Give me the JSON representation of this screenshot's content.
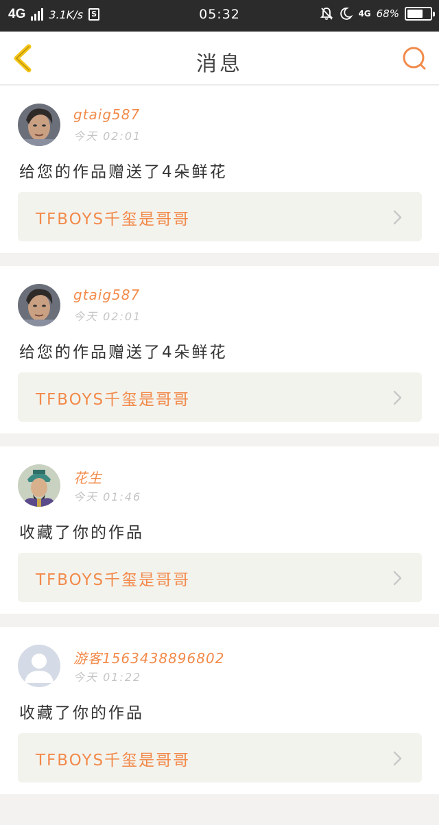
{
  "status_bar": {
    "network": "4G",
    "speed": "3.1K/s",
    "sim_icon_label": "S",
    "time": "05:32",
    "data_label": "4G",
    "battery_text": "68%",
    "battery_level": 0.68,
    "icons": [
      "signal-icon",
      "sim-icon",
      "mute-bell-icon",
      "moon-icon",
      "battery-icon"
    ]
  },
  "nav": {
    "title": "消息",
    "back_icon": "chevron-left-icon",
    "search_icon": "search-icon",
    "accent_color": "#f28a4a",
    "back_color": "#f5c518"
  },
  "messages": [
    {
      "username": "gtaig587",
      "time": "今天 02:01",
      "text": "给您的作品赠送了4朵鲜花",
      "work_title": "TFBOYS千玺是哥哥",
      "avatar": "user-photo"
    },
    {
      "username": "gtaig587",
      "time": "今天 02:01",
      "text": "给您的作品赠送了4朵鲜花",
      "work_title": "TFBOYS千玺是哥哥",
      "avatar": "user-photo"
    },
    {
      "username": "花生",
      "time": "今天 01:46",
      "text": "收藏了你的作品",
      "work_title": "TFBOYS千玺是哥哥",
      "avatar": "warrior-portrait"
    },
    {
      "username": "游客15634388​96802",
      "time": "今天 01:22",
      "text": "收藏了你的作品",
      "work_title": "TFBOYS千玺是哥哥",
      "avatar": "default-avatar"
    }
  ]
}
